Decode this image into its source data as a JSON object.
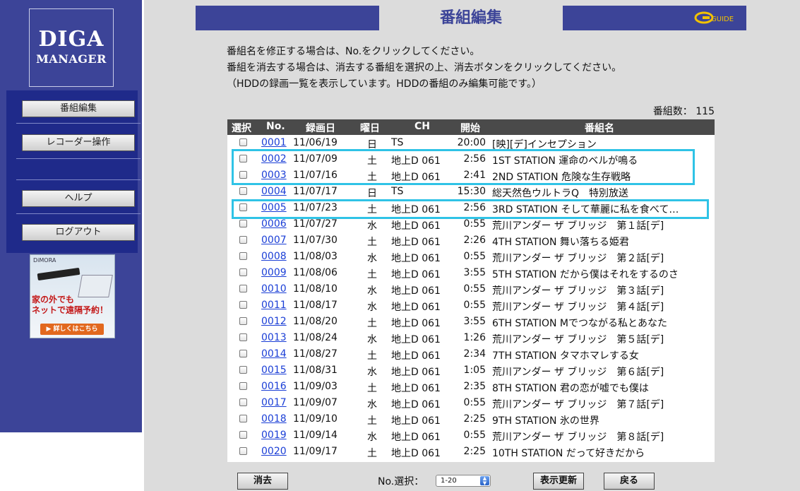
{
  "sidebar": {
    "logo_line1": "DIGA",
    "logo_line2": "MANAGER",
    "menu": [
      {
        "label": "番組編集"
      },
      {
        "label": "レコーダー操作"
      },
      {
        "label": "ヘルプ"
      },
      {
        "label": "ログアウト"
      }
    ],
    "ad": {
      "brand": "DiMORA",
      "text": "家の外でも\nネットで遠隔予約！",
      "link": "▶ 詳しくはこちら"
    }
  },
  "header": {
    "title": "番組編集",
    "guide_logo": "GUIDE"
  },
  "instructions": [
    "番組名を修正する場合は、No.をクリックしてください。",
    "番組を消去する場合は、消去する番組を選択の上、消去ボタンをクリックしてください。",
    "（HDDの録画一覧を表示しています。HDDの番組のみ編集可能です。）"
  ],
  "count": {
    "label": "番組数：",
    "value": "115"
  },
  "table": {
    "headers": {
      "select": "選択",
      "no": "No.",
      "date": "録画日",
      "dow": "曜日",
      "ch": "CH",
      "start": "開始",
      "title": "番組名"
    },
    "rows": [
      {
        "no": "0001",
        "date": "11/06/19",
        "dow": "日",
        "ch": "TS",
        "start": "20:00",
        "title": "[映][デ]インセプション"
      },
      {
        "no": "0002",
        "date": "11/07/09",
        "dow": "土",
        "ch": "地上D 061",
        "start": "2:56",
        "title": "1ST STATION 運命のベルが鳴る"
      },
      {
        "no": "0003",
        "date": "11/07/16",
        "dow": "土",
        "ch": "地上D 061",
        "start": "2:41",
        "title": "2ND STATION 危険な生存戦略"
      },
      {
        "no": "0004",
        "date": "11/07/17",
        "dow": "日",
        "ch": "TS",
        "start": "15:30",
        "title": "総天然色ウルトラQ　特別放送"
      },
      {
        "no": "0005",
        "date": "11/07/23",
        "dow": "土",
        "ch": "地上D 061",
        "start": "2:56",
        "title": "3RD STATION そして華麗に私を食べて…"
      },
      {
        "no": "0006",
        "date": "11/07/27",
        "dow": "水",
        "ch": "地上D 061",
        "start": "0:55",
        "title": "荒川アンダー ザ ブリッジ　第１話[デ]"
      },
      {
        "no": "0007",
        "date": "11/07/30",
        "dow": "土",
        "ch": "地上D 061",
        "start": "2:26",
        "title": "4TH STATION 舞い落ちる姫君"
      },
      {
        "no": "0008",
        "date": "11/08/03",
        "dow": "水",
        "ch": "地上D 061",
        "start": "0:55",
        "title": "荒川アンダー ザ ブリッジ　第２話[デ]"
      },
      {
        "no": "0009",
        "date": "11/08/06",
        "dow": "土",
        "ch": "地上D 061",
        "start": "3:55",
        "title": "5TH STATION だから僕はそれをするのさ"
      },
      {
        "no": "0010",
        "date": "11/08/10",
        "dow": "水",
        "ch": "地上D 061",
        "start": "0:55",
        "title": "荒川アンダー ザ ブリッジ　第３話[デ]"
      },
      {
        "no": "0011",
        "date": "11/08/17",
        "dow": "水",
        "ch": "地上D 061",
        "start": "0:55",
        "title": "荒川アンダー ザ ブリッジ　第４話[デ]"
      },
      {
        "no": "0012",
        "date": "11/08/20",
        "dow": "土",
        "ch": "地上D 061",
        "start": "3:55",
        "title": "6TH STATION Mでつながる私とあなた"
      },
      {
        "no": "0013",
        "date": "11/08/24",
        "dow": "水",
        "ch": "地上D 061",
        "start": "1:26",
        "title": "荒川アンダー ザ ブリッジ　第５話[デ]"
      },
      {
        "no": "0014",
        "date": "11/08/27",
        "dow": "土",
        "ch": "地上D 061",
        "start": "2:34",
        "title": "7TH STATION タマホマレする女"
      },
      {
        "no": "0015",
        "date": "11/08/31",
        "dow": "水",
        "ch": "地上D 061",
        "start": "1:05",
        "title": "荒川アンダー ザ ブリッジ　第６話[デ]"
      },
      {
        "no": "0016",
        "date": "11/09/03",
        "dow": "土",
        "ch": "地上D 061",
        "start": "2:35",
        "title": "8TH STATION 君の恋が嘘でも僕は"
      },
      {
        "no": "0017",
        "date": "11/09/07",
        "dow": "水",
        "ch": "地上D 061",
        "start": "0:55",
        "title": "荒川アンダー ザ ブリッジ　第７話[デ]"
      },
      {
        "no": "0018",
        "date": "11/09/10",
        "dow": "土",
        "ch": "地上D 061",
        "start": "2:25",
        "title": "9TH STATION 氷の世界"
      },
      {
        "no": "0019",
        "date": "11/09/14",
        "dow": "水",
        "ch": "地上D 061",
        "start": "0:55",
        "title": "荒川アンダー ザ ブリッジ　第８話[デ]"
      },
      {
        "no": "0020",
        "date": "11/09/17",
        "dow": "土",
        "ch": "地上D 061",
        "start": "2:25",
        "title": "10TH STATION だって好きだから"
      }
    ]
  },
  "controls": {
    "delete_label": "消去",
    "select_label": "No.選択：",
    "select_value": "1-20",
    "refresh_label": "表示更新",
    "back_label": "戻る"
  },
  "colors": {
    "sidebar_bg": "#3c4498",
    "menu_panel_bg": "#1f2a8a",
    "highlight": "#2fc3e6",
    "link": "#1a3ed6"
  }
}
